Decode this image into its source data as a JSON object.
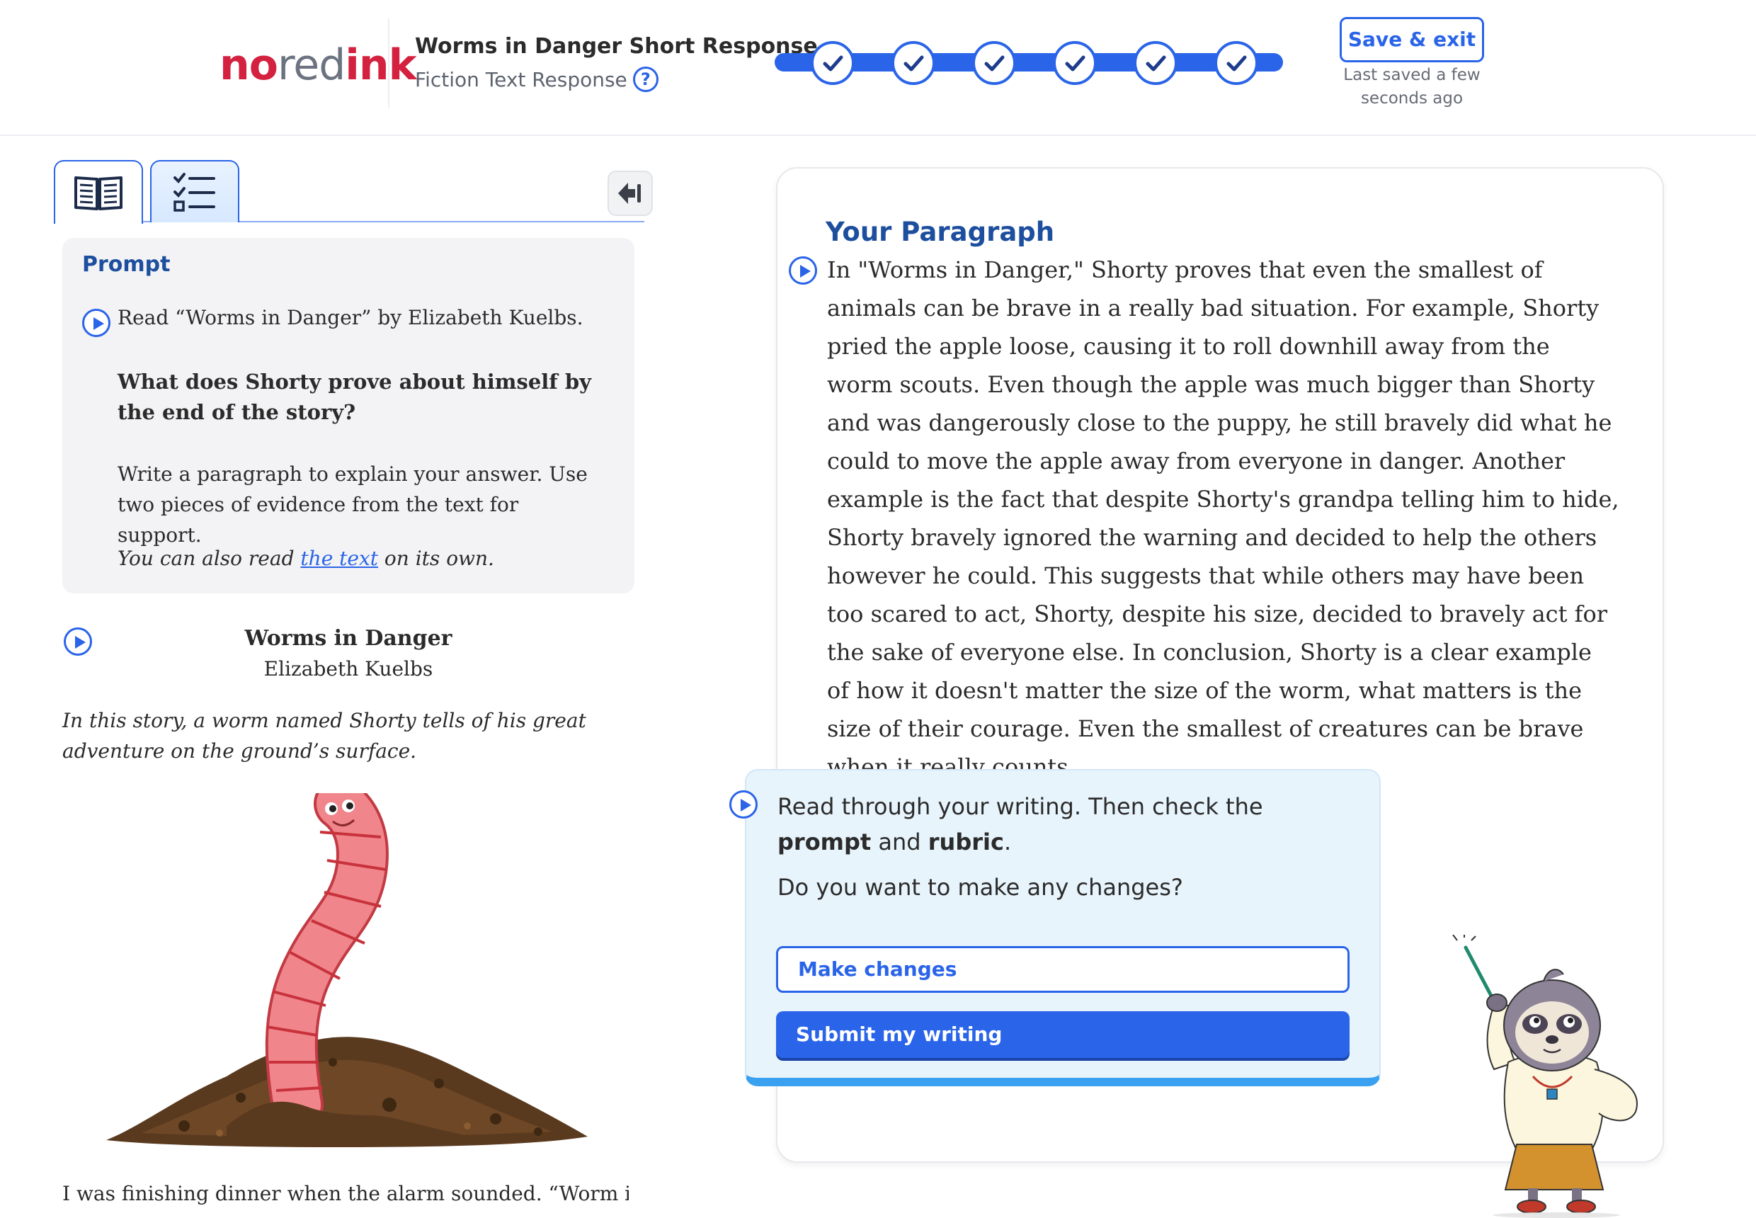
{
  "header": {
    "logo": {
      "part1": "no",
      "part2": "red",
      "part3": "ink"
    },
    "assignment_title": "Worms in Danger Short Response",
    "assignment_subtitle": "Fiction Text Response",
    "help_icon": "question-icon",
    "progress": {
      "steps_total": 6,
      "steps_complete": 6
    },
    "save_exit_label": "Save & exit",
    "last_saved": "Last saved a few seconds ago",
    "accent_color": "#2a64e8",
    "brand_color": "#d3213f"
  },
  "left_panel": {
    "tabs": [
      {
        "name": "text",
        "icon": "book-icon"
      },
      {
        "name": "rubric",
        "icon": "checklist-icon"
      }
    ],
    "collapse_icon": "collapse-panel-icon",
    "prompt": {
      "label": "Prompt",
      "read_line": "Read “Worms in Danger” by Elizabeth Kuelbs.",
      "question": "What does Shorty prove about himself by the end of the story?",
      "instructions": "Write a paragraph to explain your answer. Use two pieces of evidence from the text for support.",
      "also_read_before": "You can also read ",
      "also_read_link": "the text",
      "also_read_after": " on its own."
    },
    "story": {
      "title": "Worms in Danger",
      "author": "Elizabeth Kuelbs",
      "intro": "In this story, a worm named Shorty tells of his great adventure on the ground’s surface.",
      "body_start": "I was finishing dinner when the alarm sounded. “Worm in"
    }
  },
  "right_panel": {
    "heading": "Your Paragraph",
    "paragraph": "In \"Worms in Danger,\" Shorty proves that even the smallest of animals can be brave in a really bad situation. For example, Shorty pried the apple loose, causing it to roll downhill away from the worm scouts. Even though the apple was much bigger than Shorty and was dangerously close to the puppy, he still bravely did what he could to move the apple away from everyone in danger. Another example is the fact that despite Shorty's grandpa telling him to hide, Shorty bravely ignored the warning and decided to help the others however he could. This suggests that while others may have been too scared to act, Shorty, despite his size, decided to bravely act for the sake of everyone else. In conclusion, Shorty is a clear example of how it doesn't matter the size of the worm, what matters is the size of their courage. Even the smallest of creatures can be brave when it really counts.",
    "guidance": {
      "text_before_prompt": "Read through your writing. Then check the ",
      "prompt_word": "prompt",
      "text_and": " and ",
      "rubric_word": "rubric",
      "text_end": ".",
      "question": "Do you want to make any changes?",
      "make_changes_label": "Make changes",
      "submit_label": "Submit my writing"
    }
  }
}
